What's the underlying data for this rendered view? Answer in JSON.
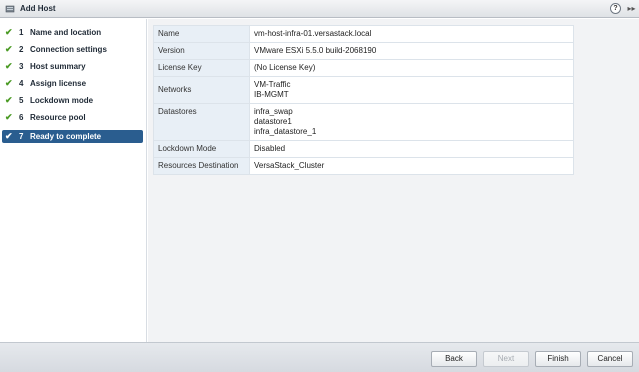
{
  "window": {
    "title": "Add Host",
    "help_glyph": "?",
    "expand_glyph": "▸▸"
  },
  "sidebar": {
    "items": [
      {
        "num": "1",
        "label": "Name and location",
        "check": "✔"
      },
      {
        "num": "2",
        "label": "Connection settings",
        "check": "✔"
      },
      {
        "num": "3",
        "label": "Host summary",
        "check": "✔"
      },
      {
        "num": "4",
        "label": "Assign license",
        "check": "✔"
      },
      {
        "num": "5",
        "label": "Lockdown mode",
        "check": "✔"
      },
      {
        "num": "6",
        "label": "Resource pool",
        "check": "✔"
      },
      {
        "num": "7",
        "label": "Ready to complete",
        "check": "✔"
      }
    ],
    "active_index": 6
  },
  "summary": {
    "rows": [
      {
        "key": "Name",
        "value": "vm-host-infra-01.versastack.local"
      },
      {
        "key": "Version",
        "value": "VMware ESXi 5.5.0 build-2068190"
      },
      {
        "key": "License Key",
        "value": "(No License Key)"
      },
      {
        "key": "Networks",
        "lines": [
          "VM-Traffic",
          "IB-MGMT"
        ]
      },
      {
        "key": "Datastores",
        "lines": [
          "infra_swap",
          "datastore1",
          "infra_datastore_1"
        ]
      },
      {
        "key": "Lockdown Mode",
        "value": "Disabled"
      },
      {
        "key": "Resources Destination",
        "value": "VersaStack_Cluster"
      }
    ]
  },
  "footer": {
    "back_label": "Back",
    "next_label": "Next",
    "finish_label": "Finish",
    "cancel_label": "Cancel"
  },
  "colors": {
    "accent_selected": "#2a5d8f",
    "check_green": "#4a9a23",
    "key_cell_bg": "#e8eff6"
  }
}
